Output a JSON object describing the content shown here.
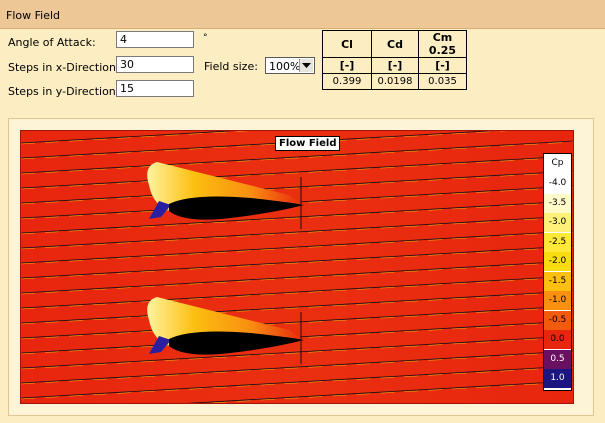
{
  "header": {
    "title": "Flow Field"
  },
  "inputs": {
    "angle_label": "Angle of Attack:",
    "angle_value": "4",
    "angle_unit": "°",
    "steps_x_label": "Steps in x-Direction:",
    "steps_x_value": "30",
    "steps_y_label": "Steps in y-Direction:",
    "steps_y_value": "15"
  },
  "field_size": {
    "label": "Field size:",
    "value": "100%"
  },
  "coefficients": {
    "headers": [
      "Cl",
      "Cd",
      "Cm 0.25"
    ],
    "units": [
      "[-]",
      "[-]",
      "[-]"
    ],
    "values": [
      "0.399",
      "0.0198",
      "0.035"
    ]
  },
  "plot": {
    "title": "Flow Field",
    "legend_title": "Cp",
    "legend": [
      {
        "label": "-4.0",
        "color": "#ffffff"
      },
      {
        "label": "-3.5",
        "color": "#fffbc8"
      },
      {
        "label": "-3.0",
        "color": "#fff07a"
      },
      {
        "label": "-2.5",
        "color": "#ffe838"
      },
      {
        "label": "-2.0",
        "color": "#f7dc10"
      },
      {
        "label": "-1.5",
        "color": "#fbbf10"
      },
      {
        "label": "-1.0",
        "color": "#f99010"
      },
      {
        "label": "-0.5",
        "color": "#f25a0e"
      },
      {
        "label": "0.0",
        "color": "#e8260e"
      },
      {
        "label": "0.5",
        "color": "#6a1060"
      },
      {
        "label": "1.0",
        "color": "#1c1680"
      }
    ],
    "background_color": "#e8260e",
    "streamline_color": "#111111"
  }
}
